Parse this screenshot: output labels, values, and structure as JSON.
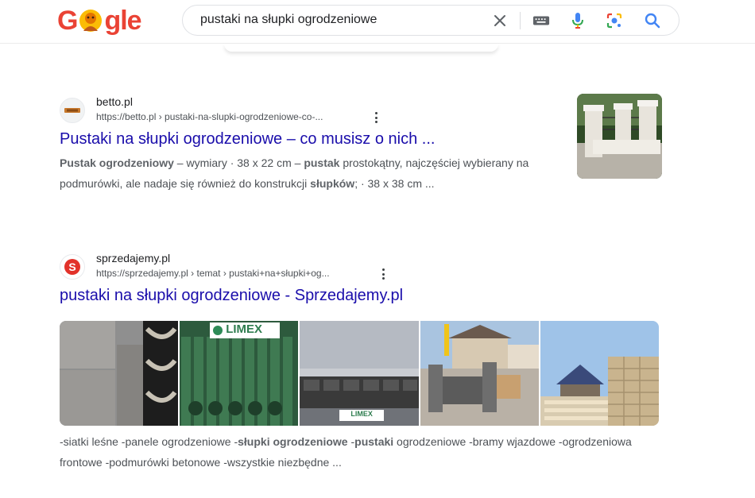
{
  "header": {
    "logo_text_prefix": "G",
    "logo_text_suffix": "gle",
    "search_query": "pustaki na słupki ogrodzeniowe"
  },
  "icons": {
    "clear": "close-icon",
    "keyboard": "keyboard-icon",
    "voice": "microphone-icon",
    "lens": "lens-icon",
    "search": "search-icon"
  },
  "colors": {
    "link": "#1a0dab",
    "snippet": "#4d5156",
    "mic_blue": "#4285f4",
    "google_red": "#ea4335",
    "google_yellow": "#fbbc05",
    "google_green": "#34a853"
  },
  "results": [
    {
      "site_name": "betto.pl",
      "url": "https://betto.pl › pustaki-na-slupki-ogrodzeniowe-co-...",
      "title": "Pustaki na słupki ogrodzeniowe – co musisz o nich ...",
      "snippet_parts": [
        {
          "text": "Pustak ogrodzeniowy",
          "bold": true
        },
        {
          "text": " – wymiary · 38 x 22 cm – ",
          "bold": false
        },
        {
          "text": "pustak",
          "bold": true
        },
        {
          "text": " prostokątny, najczęściej wybierany na podmurówki, ale nadaje się również do konstrukcji ",
          "bold": false
        },
        {
          "text": "słupków",
          "bold": true
        },
        {
          "text": "; · 38 x 38 cm ...",
          "bold": false
        }
      ]
    },
    {
      "site_name": "sprzedajemy.pl",
      "url": "https://sprzedajemy.pl › temat › pustaki+na+słupki+og...",
      "title": "pustaki na słupki ogrodzeniowe - Sprzedajemy.pl",
      "image_labels": [
        "LIMEX",
        "LIMEX"
      ],
      "snippet_parts": [
        {
          "text": "-siatki leśne -panele ogrodzeniowe -",
          "bold": false
        },
        {
          "text": "słupki ogrodzeniowe",
          "bold": true
        },
        {
          "text": " -",
          "bold": false
        },
        {
          "text": "pustaki",
          "bold": true
        },
        {
          "text": " ogrodzeniowe -bramy wjazdowe -ogrodzeniowa frontowe -podmurówki betonowe -wszystkie niezbędne ...",
          "bold": false
        }
      ]
    }
  ]
}
